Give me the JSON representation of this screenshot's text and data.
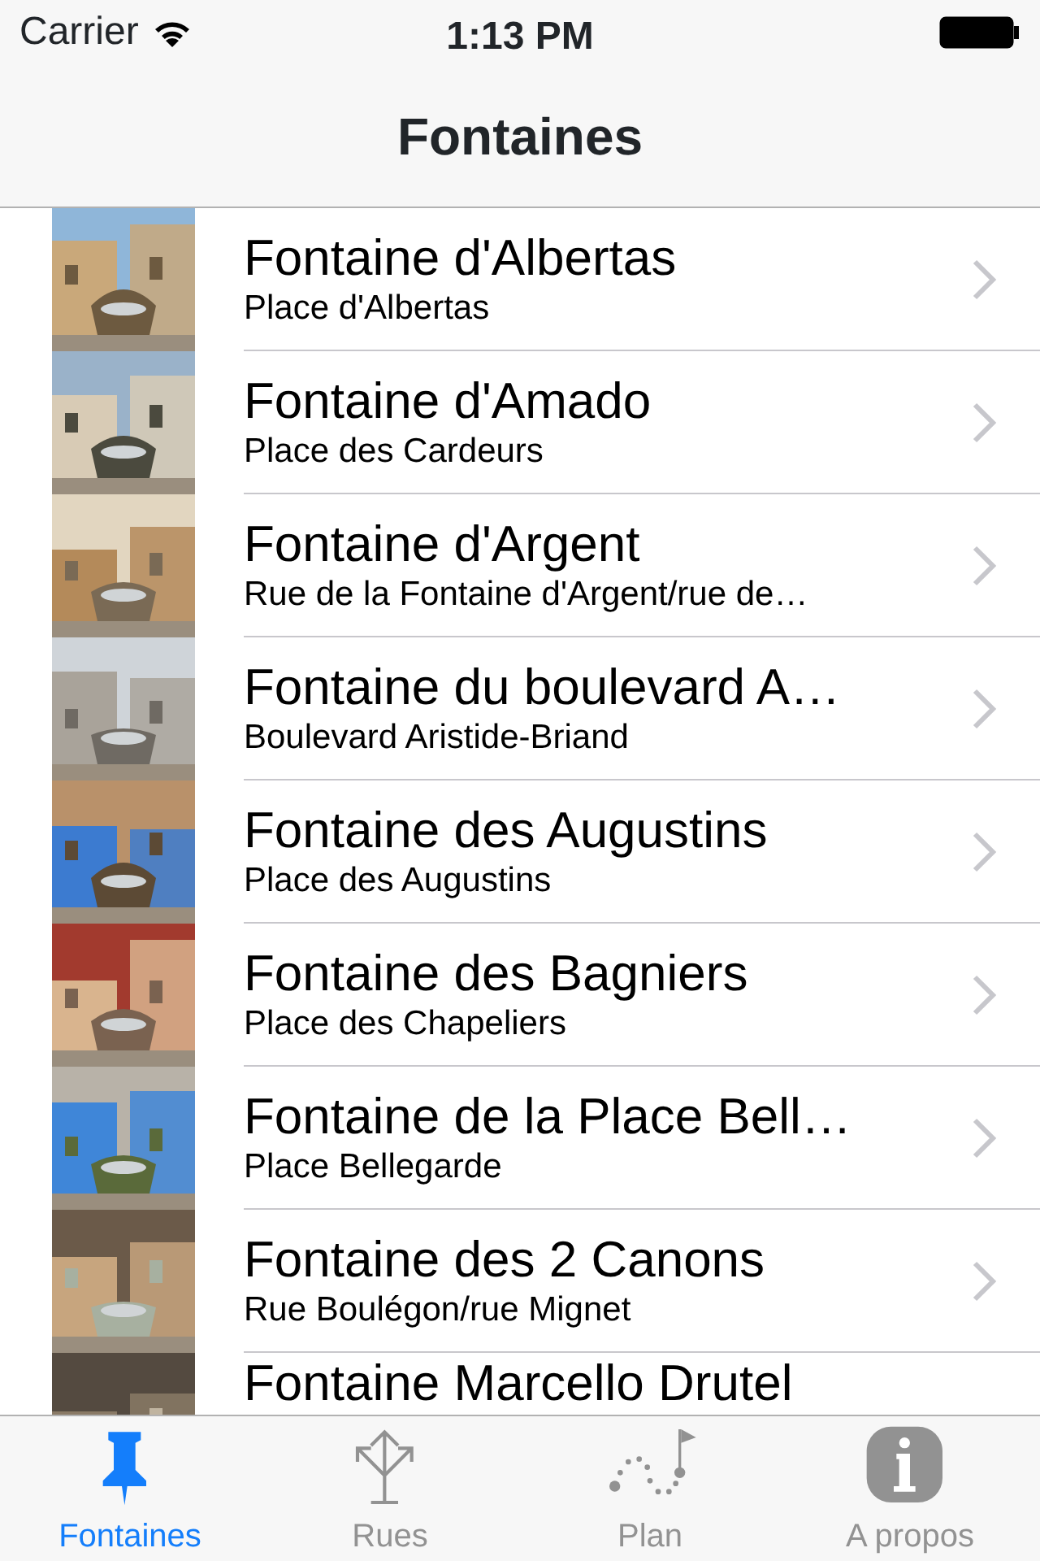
{
  "status_bar": {
    "carrier": "Carrier",
    "time": "1:13 PM"
  },
  "nav_bar": {
    "title": "Fontaines"
  },
  "rows": [
    {
      "title": "Fontaine d'Albertas",
      "subtitle": "Place d'Albertas"
    },
    {
      "title": "Fontaine d'Amado",
      "subtitle": "Place des Cardeurs"
    },
    {
      "title": "Fontaine d'Argent",
      "subtitle": "Rue de la Fontaine d'Argent/rue de…"
    },
    {
      "title": "Fontaine du boulevard A…",
      "subtitle": "Boulevard Aristide-Briand"
    },
    {
      "title": "Fontaine des Augustins",
      "subtitle": "Place des Augustins"
    },
    {
      "title": "Fontaine des Bagniers",
      "subtitle": "Place des Chapeliers"
    },
    {
      "title": "Fontaine de la Place Bell…",
      "subtitle": "Place Bellegarde"
    },
    {
      "title": "Fontaine des 2 Canons",
      "subtitle": "Rue Boulégon/rue Mignet"
    },
    {
      "title": "Fontaine Marcello Drutel"
    }
  ],
  "tab_bar": [
    {
      "kind": "pin",
      "label": "Fontaines",
      "selected": true
    },
    {
      "kind": "arrows",
      "label": "Rues",
      "selected": false
    },
    {
      "kind": "route",
      "label": "Plan",
      "selected": false
    },
    {
      "kind": "info",
      "label": "A propos",
      "selected": false
    }
  ]
}
